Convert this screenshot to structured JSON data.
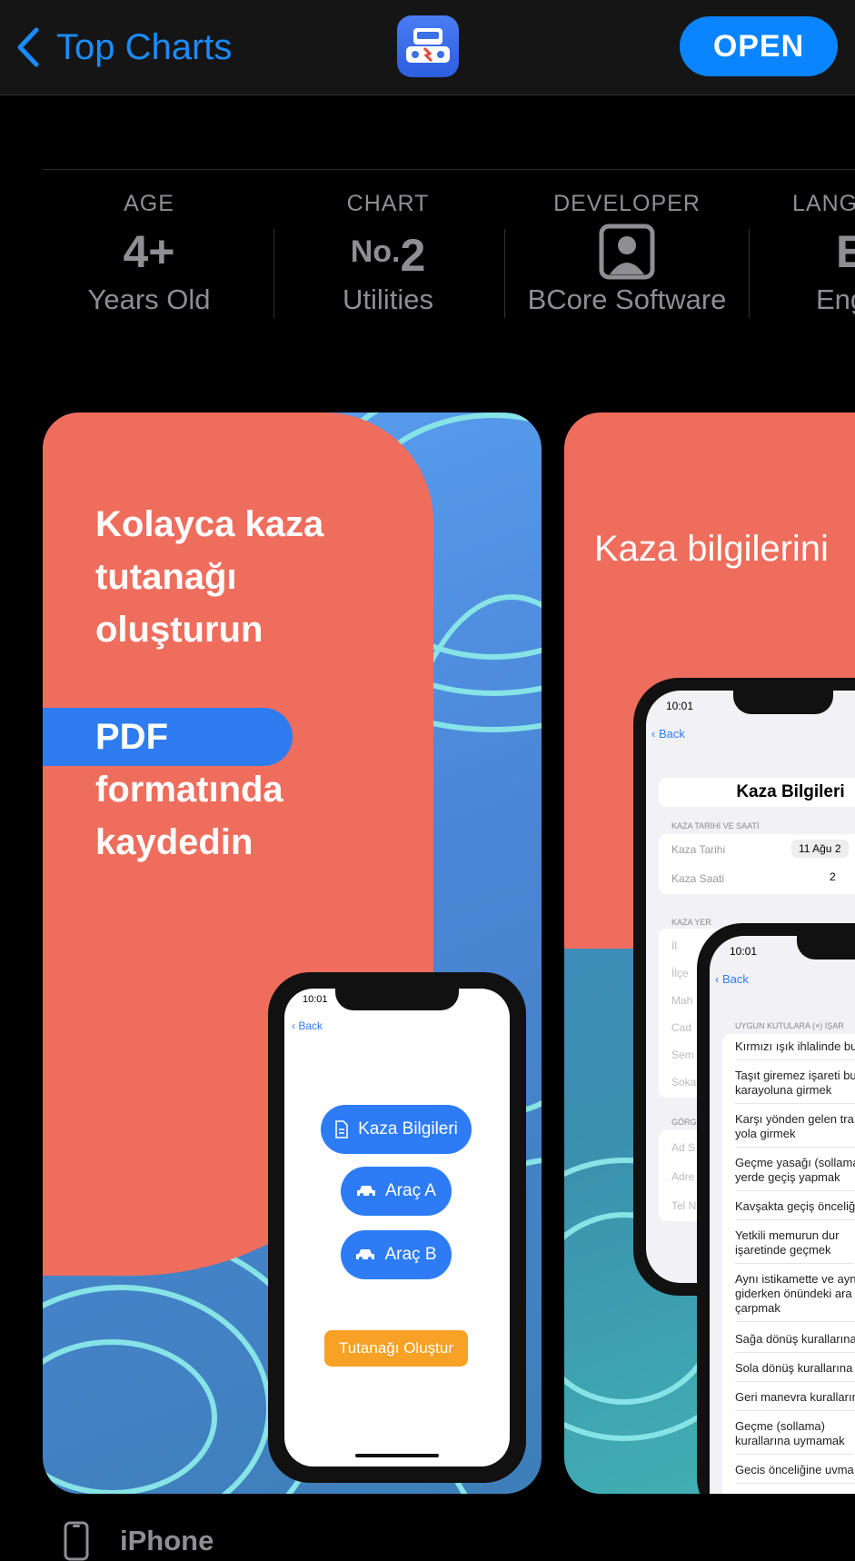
{
  "nav": {
    "back_label": "Top Charts",
    "open_label": "OPEN",
    "accent": "#0a84ff"
  },
  "info": {
    "age": {
      "label": "AGE",
      "value": "4+",
      "sub": "Years Old"
    },
    "chart": {
      "label": "CHART",
      "prefix": "No.",
      "value": "2",
      "sub": "Utilities"
    },
    "developer": {
      "label": "DEVELOPER",
      "icon": "person-square-icon",
      "sub": "BCore Software"
    },
    "language": {
      "label": "LANG",
      "value": "E",
      "sub": "Eng"
    }
  },
  "shot1": {
    "line1": "Kolayca kaza",
    "line2": "tutanağı",
    "line3": "oluşturun",
    "pdf": "PDF",
    "line5": "formatında",
    "line6": "kaydedin",
    "phone": {
      "time": "10:01",
      "back": "Back",
      "btn1": "Kaza Bilgileri",
      "btn2": "Araç A",
      "btn3": "Araç B",
      "btn4": "Tutanağı Oluştur"
    }
  },
  "shot2": {
    "title": "Kaza bilgilerini",
    "phoneA": {
      "time": "10:01",
      "back": "Back",
      "header": "Kaza Bilgileri",
      "section1": "KAZA TARİHİ VE SAATİ",
      "date_label": "Kaza Tarihi",
      "date_value": "11 Ağu 2",
      "time_label": "Kaza Saati",
      "time_value": "2",
      "section2": "KAZA YER",
      "fields": [
        "İl",
        "İlçe",
        "Mah",
        "Cad",
        "Sem",
        "Sokak"
      ],
      "section3": "GÖRG",
      "fields2": [
        "Ad S",
        "Adre",
        "Tel N"
      ]
    },
    "phoneB": {
      "time": "10:01",
      "back": "Back",
      "section": "UYGUN KUTULARA (×) İŞAR",
      "rows": [
        "Kırmızı ışık ihlalinde bu",
        "Taşıt giremez işareti bu karayoluna girmek",
        "Karşı yönden gelen tra yola girmek",
        "Geçme yasağı (sollama yerde geçiş yapmak",
        "Kavşakta geçiş önceliğ",
        "Yetkili memurun dur işaretinde geçmek",
        "Aynı istikamette ve ayn giderken önündeki ara çarpmak",
        "Sağa dönüş kurallarına",
        "Sola dönüş kurallarına",
        "Geri manevra kuralların",
        "Geçme (sollama) kurallarına uymamak",
        "Gecis önceliğine uvma"
      ]
    }
  },
  "device": {
    "label": "iPhone"
  }
}
